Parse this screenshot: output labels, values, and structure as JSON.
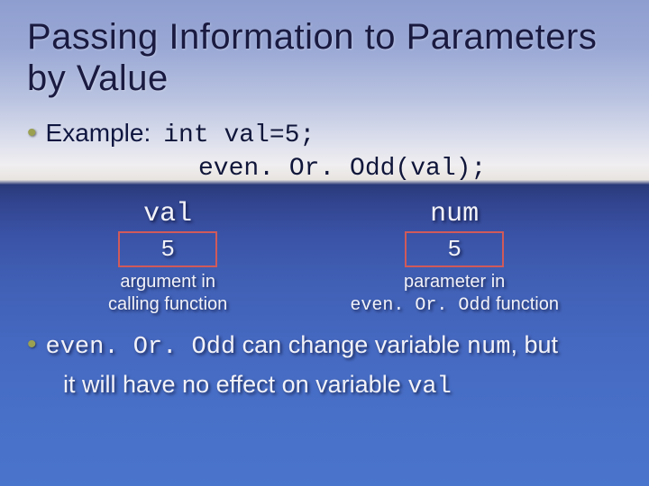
{
  "title": "Passing Information to Parameters by Value",
  "bullet1": {
    "label": "Example:",
    "code1": "int val=5;",
    "code2": "even. Or. Odd(val);"
  },
  "vars": {
    "left": {
      "name": "val",
      "value": "5",
      "caption1": "argument in",
      "caption2": "calling function"
    },
    "right": {
      "name": "num",
      "value": "5",
      "caption1": "parameter in",
      "caption2a": "even. Or. Odd",
      "caption2b": " function"
    }
  },
  "bullet2": {
    "mono1": "even. Or. Odd",
    "text1": " can change variable ",
    "mono2": "num",
    "text2": ", but",
    "line2a": "it will have no effect on variable ",
    "mono3": "val"
  }
}
